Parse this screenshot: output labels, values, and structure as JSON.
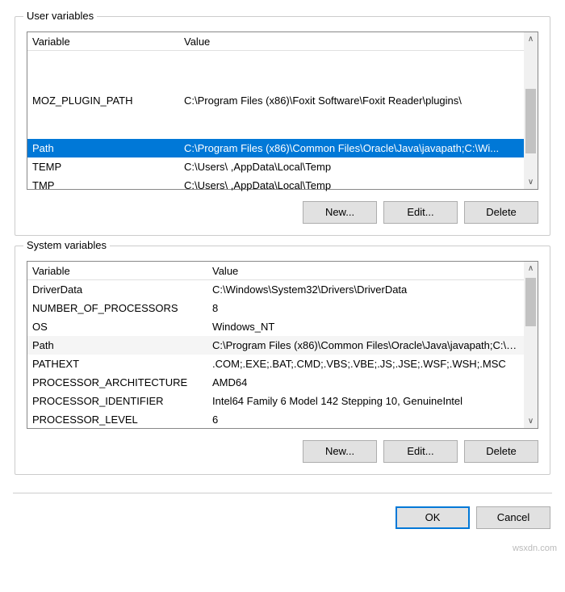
{
  "user": {
    "title": "User variables",
    "columns": {
      "var": "Variable",
      "val": "Value"
    },
    "rows": [
      {
        "var": "MOZ_PLUGIN_PATH",
        "val": "C:\\Program Files (x86)\\Foxit Software\\Foxit Reader\\plugins\\",
        "selected": false,
        "pad": true
      },
      {
        "var": "Path",
        "val": "C:\\Program Files (x86)\\Common Files\\Oracle\\Java\\javapath;C:\\Wi...",
        "selected": true
      },
      {
        "var": "TEMP",
        "val": "C:\\Users\\            ,AppData\\Local\\Temp",
        "selected": false
      },
      {
        "var": "TMP",
        "val": "C:\\Users\\           ,AppData\\Local\\Temp",
        "selected": false
      }
    ],
    "buttons": {
      "new": "New...",
      "edit": "Edit...",
      "del": "Delete"
    }
  },
  "system": {
    "title": "System variables",
    "columns": {
      "var": "Variable",
      "val": "Value"
    },
    "rows": [
      {
        "var": "DriverData",
        "val": "C:\\Windows\\System32\\Drivers\\DriverData"
      },
      {
        "var": "NUMBER_OF_PROCESSORS",
        "val": "8"
      },
      {
        "var": "OS",
        "val": "Windows_NT"
      },
      {
        "var": "Path",
        "val": "C:\\Program Files (x86)\\Common Files\\Oracle\\Java\\javapath;C:\\Wi...",
        "hover": true
      },
      {
        "var": "PATHEXT",
        "val": ".COM;.EXE;.BAT;.CMD;.VBS;.VBE;.JS;.JSE;.WSF;.WSH;.MSC"
      },
      {
        "var": "PROCESSOR_ARCHITECTURE",
        "val": "AMD64"
      },
      {
        "var": "PROCESSOR_IDENTIFIER",
        "val": "Intel64 Family 6 Model 142 Stepping 10, GenuineIntel"
      },
      {
        "var": "PROCESSOR_LEVEL",
        "val": "6"
      }
    ],
    "buttons": {
      "new": "New...",
      "edit": "Edit...",
      "del": "Delete"
    }
  },
  "dialog": {
    "ok": "OK",
    "cancel": "Cancel"
  },
  "watermark": "wsxdn.com"
}
